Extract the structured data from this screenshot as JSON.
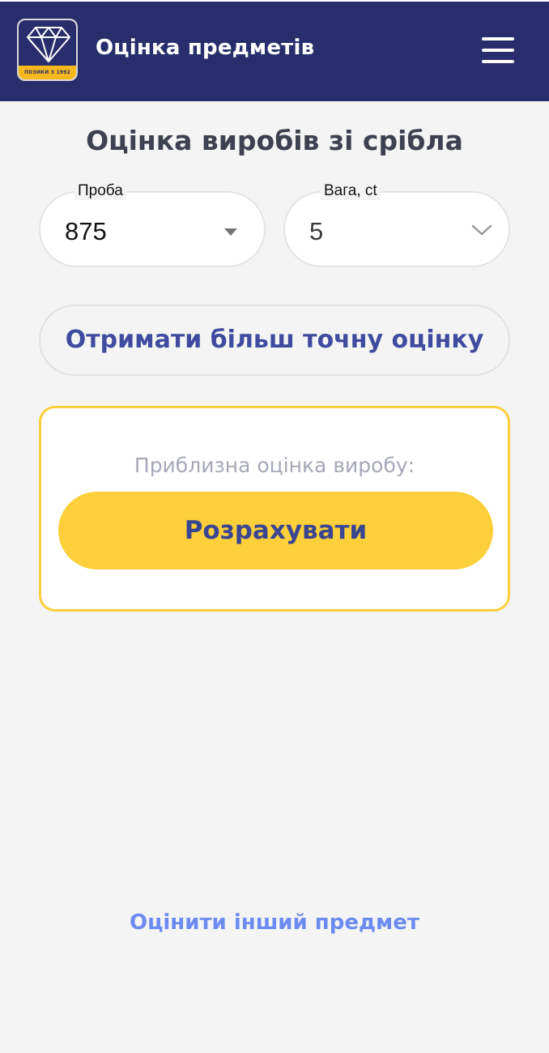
{
  "header": {
    "title": "Оцінка предметів",
    "logo_caption": "ПОЗИКИ З 1992",
    "logo_icon": "diamond-icon",
    "menu_icon": "hamburger-menu-icon"
  },
  "page": {
    "title": "Оцінка виробів зі срібла"
  },
  "form": {
    "proba": {
      "label": "Проба",
      "value": "875"
    },
    "vaga": {
      "label": "Вага, ct",
      "value": "5"
    }
  },
  "actions": {
    "precise_label": "Отримати більш точну оцінку",
    "other_item_label": "Оцінити інший предмет"
  },
  "result": {
    "label": "Приблизна оцінка виробу:",
    "calculate_label": "Розрахувати"
  },
  "colors": {
    "header_bg": "#282e6b",
    "accent_yellow": "#fdcf3a",
    "primary_text": "#3f4b9f",
    "link": "#6c8bf0"
  }
}
